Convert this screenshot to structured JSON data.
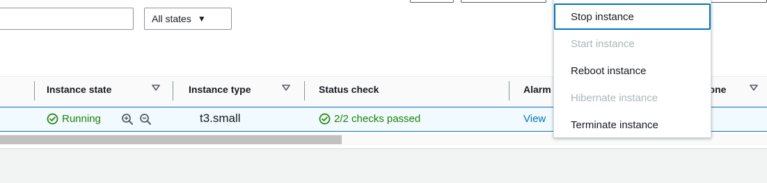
{
  "filters": {
    "search_placeholder": "",
    "states_select": {
      "value": "All states"
    }
  },
  "table": {
    "columns": [
      {
        "label": "Instance state",
        "sortable": true
      },
      {
        "label": "Instance type",
        "sortable": true
      },
      {
        "label": "Status check",
        "sortable": false
      },
      {
        "label": "Alarm",
        "sortable": false
      },
      {
        "label": "Zone",
        "sortable": true
      }
    ],
    "row": {
      "instance_state": "Running",
      "instance_type": "t3.small",
      "status_check": "2/2 checks passed",
      "alarm_link": "View"
    }
  },
  "menu": {
    "items": [
      {
        "label": "Stop instance",
        "enabled": true,
        "focused": true
      },
      {
        "label": "Start instance",
        "enabled": false
      },
      {
        "label": "Reboot instance",
        "enabled": true
      },
      {
        "label": "Hibernate instance",
        "enabled": false
      },
      {
        "label": "Terminate instance",
        "enabled": true
      }
    ]
  },
  "colors": {
    "accent": "#0073bb",
    "success": "#1d8102",
    "disabled": "#aab7b8",
    "row_selected_bg": "#f1faff"
  }
}
